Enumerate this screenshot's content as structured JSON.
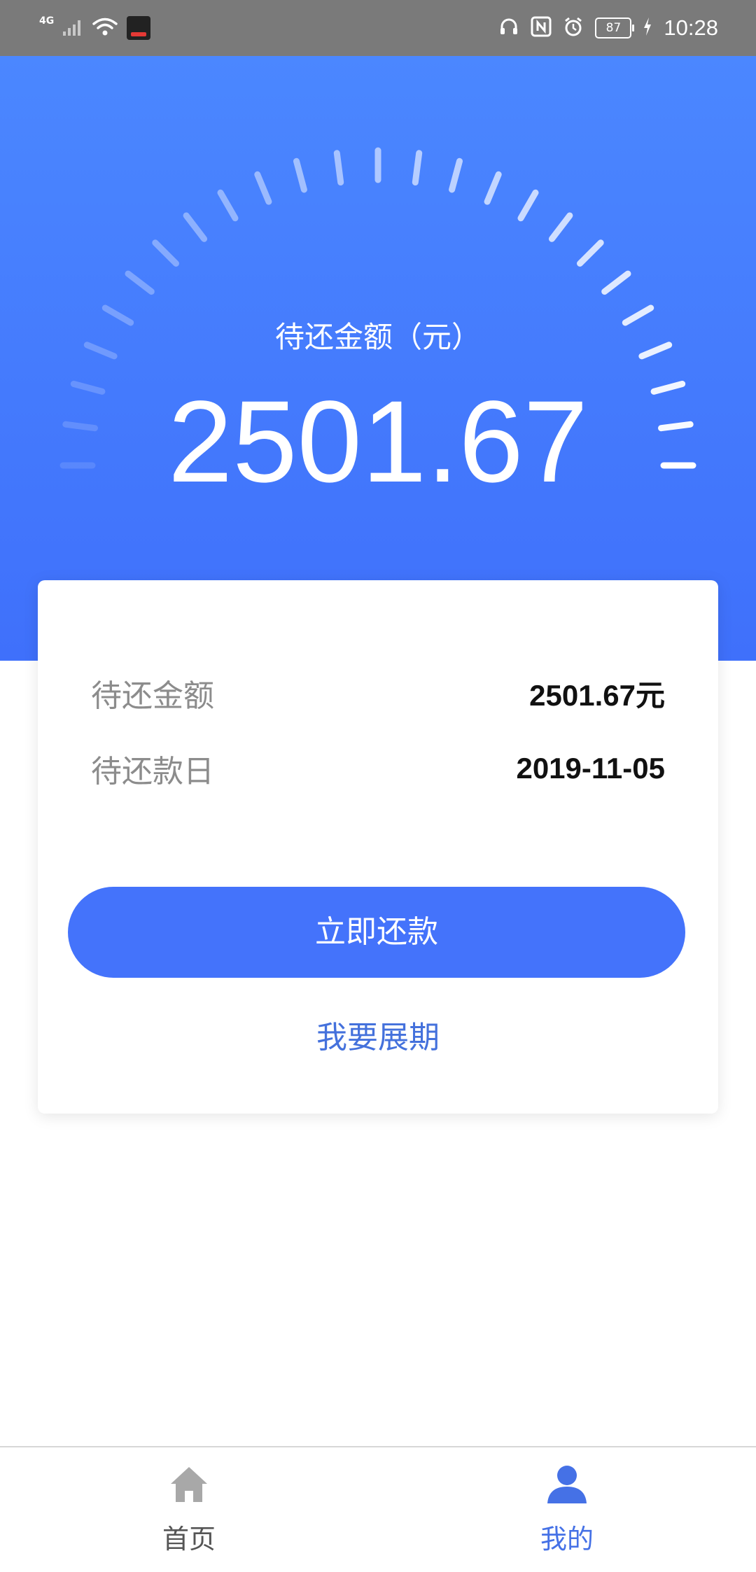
{
  "status_bar": {
    "network": "4G",
    "battery": "87",
    "time": "10:28",
    "icons": [
      "signal-icon",
      "wifi-icon",
      "app-notification-icon",
      "headphones-icon",
      "nfc-icon",
      "alarm-icon",
      "battery-icon",
      "charging-icon"
    ]
  },
  "header": {
    "label": "待还金额（元）",
    "amount": "2501.67",
    "background_color": "#4b87ff",
    "gauge_fill_fraction": 1.0
  },
  "card": {
    "rows": [
      {
        "label": "待还金额",
        "value": "2501.67元"
      },
      {
        "label": "待还款日",
        "value": "2019-11-05"
      }
    ],
    "primary_button": "立即还款",
    "secondary_link": "我要展期",
    "accent_color": "#4473fb"
  },
  "bottom_nav": {
    "items": [
      {
        "label": "首页",
        "icon": "home-icon",
        "active": false
      },
      {
        "label": "我的",
        "icon": "user-icon",
        "active": true
      }
    ],
    "active_color": "#4571e6",
    "inactive_color": "#555555"
  }
}
